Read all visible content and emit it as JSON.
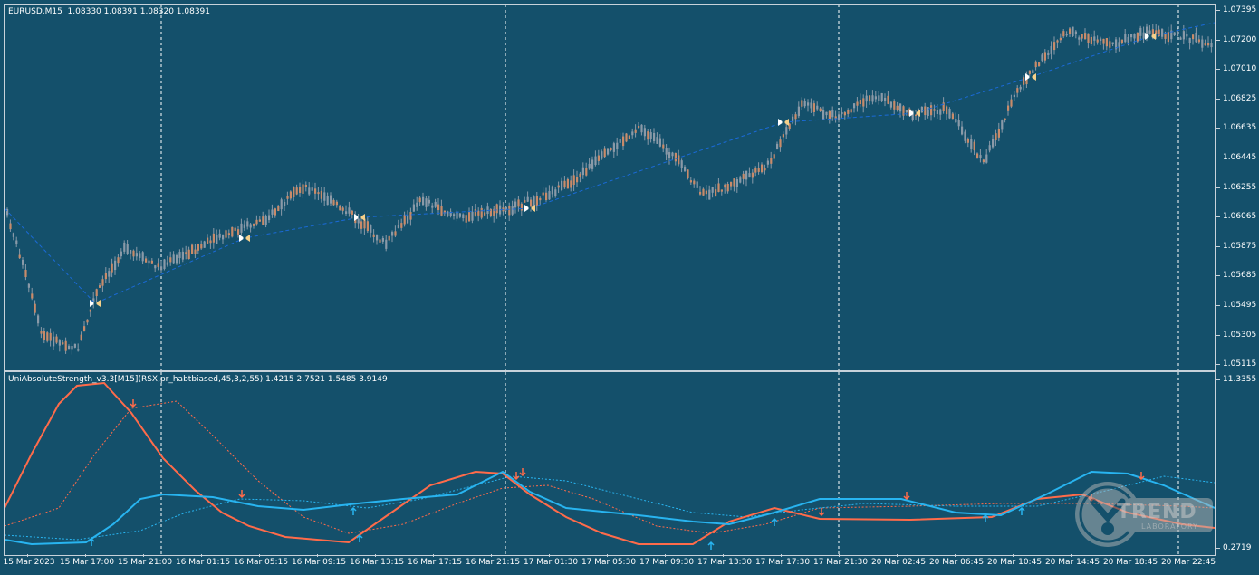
{
  "main_chart": {
    "title": "EURUSD,M15  1.08330 1.08391 1.08320 1.08391",
    "price_levels": [
      "1.07395",
      "1.07200",
      "1.07010",
      "1.06825",
      "1.06635",
      "1.06445",
      "1.06255",
      "1.06065",
      "1.05875",
      "1.05685",
      "1.05495",
      "1.05305",
      "1.05115"
    ]
  },
  "indicator": {
    "title": "UniAbsoluteStrength_v3.3[M15](RSX,pr_habtbiased,45,3,2,55) 1.4215 2.7521 1.5485 3.9149",
    "scale_top": "11.3355",
    "scale_bottom": "0.2719"
  },
  "time_axis": [
    "15 Mar 2023",
    "15 Mar 17:00",
    "15 Mar 21:00",
    "16 Mar 01:15",
    "16 Mar 05:15",
    "16 Mar 09:15",
    "16 Mar 13:15",
    "16 Mar 17:15",
    "16 Mar 21:15",
    "17 Mar 01:30",
    "17 Mar 05:30",
    "17 Mar 09:30",
    "17 Mar 13:30",
    "17 Mar 17:30",
    "17 Mar 21:30",
    "20 Mar 02:45",
    "20 Mar 06:45",
    "20 Mar 10:45",
    "20 Mar 14:45",
    "20 Mar 18:45",
    "20 Mar 22:45"
  ],
  "watermark": {
    "name": "TREND",
    "sub": "LABORATORY"
  },
  "colors": {
    "background": "#14506b",
    "bull_candle": "#8a9aa8",
    "bear_candle": "#c98b6a",
    "trend_line": "#1a6ad8",
    "bulls_line": "#ff6b4a",
    "bears_line": "#28b4f0",
    "grid": "#ffffff"
  },
  "icons": [
    "fractal-marker-icon",
    "arrow-down-icon",
    "arrow-up-icon"
  ]
}
